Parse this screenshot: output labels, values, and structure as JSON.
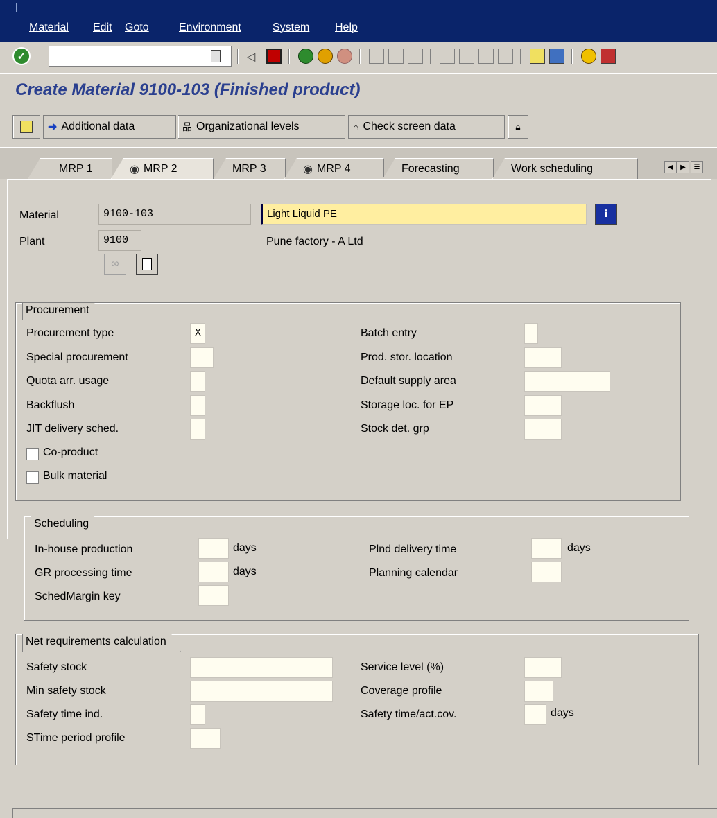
{
  "menubar": {
    "items": [
      "Material",
      "Edit",
      "Goto",
      "Environment",
      "System",
      "Help"
    ]
  },
  "toolbar": {
    "command_field_value": ""
  },
  "header": {
    "title": "Create Material 9100-103 (Finished product)"
  },
  "app_toolbar": {
    "additional_data": "Additional data",
    "org_levels": "Organizational levels",
    "check_screen": "Check screen data"
  },
  "tabs": [
    {
      "label": "MRP 1"
    },
    {
      "label": "MRP 2"
    },
    {
      "label": "MRP 3"
    },
    {
      "label": "MRP 4"
    },
    {
      "label": "Forecasting"
    },
    {
      "label": "Work scheduling"
    }
  ],
  "header_fields": {
    "material_label": "Material",
    "material_value": "9100-103",
    "material_desc": "Light Liquid PE",
    "plant_label": "Plant",
    "plant_value": "9100",
    "plant_desc": "Pune factory -  A Ltd"
  },
  "procurement": {
    "title": "Procurement",
    "procurement_type_label": "Procurement type",
    "procurement_type_value": "X",
    "special_procurement_label": "Special procurement",
    "quota_label": "Quota arr. usage",
    "backflush_label": "Backflush",
    "jit_label": "JIT delivery sched.",
    "coproduct_label": "Co-product",
    "bulk_label": "Bulk material",
    "batch_entry_label": "Batch entry",
    "prod_stor_label": "Prod. stor. location",
    "default_supply_label": "Default supply area",
    "storage_ep_label": "Storage loc. for EP",
    "stock_det_label": "Stock det. grp"
  },
  "scheduling": {
    "title": "Scheduling",
    "inhouse_label": "In-house production",
    "gr_label": "GR processing time",
    "sched_margin_label": "SchedMargin key",
    "plnd_delivery_label": "Plnd delivery time",
    "planning_cal_label": "Planning calendar",
    "days_unit": "days"
  },
  "net_req": {
    "title": "Net requirements calculation",
    "safety_stock_label": "Safety stock",
    "min_safety_label": "Min safety stock",
    "safety_time_ind_label": "Safety time ind.",
    "stime_period_label": "STime period profile",
    "service_level_label": "Service level (%)",
    "coverage_label": "Coverage profile",
    "safety_time_cov_label": "Safety time/act.cov.",
    "days_unit": "days"
  }
}
